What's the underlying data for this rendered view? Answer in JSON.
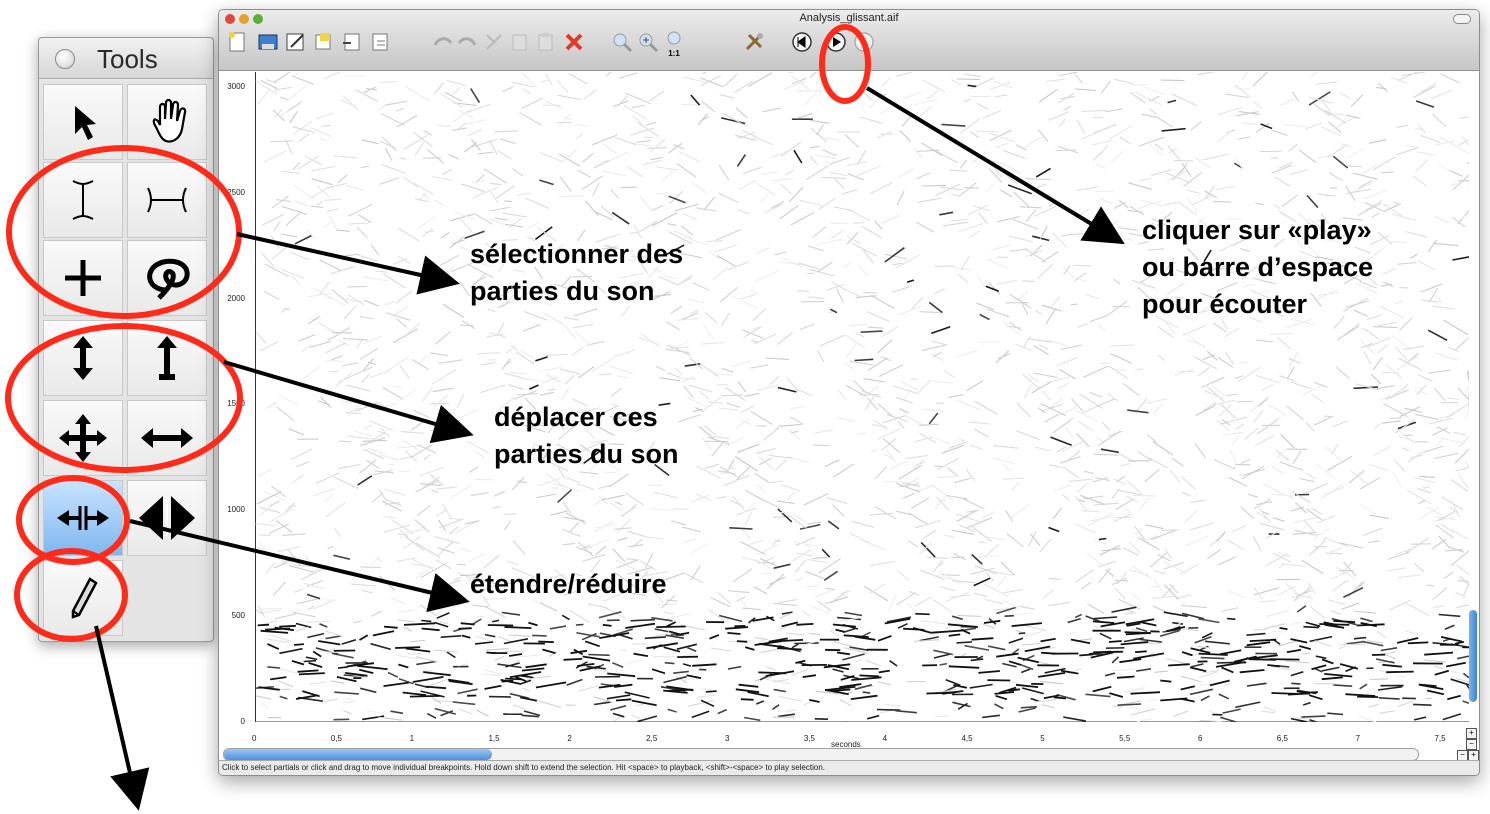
{
  "tools_palette": {
    "title": "Tools",
    "tools": [
      {
        "icon": "arrow-pointer-icon"
      },
      {
        "icon": "hand-icon"
      },
      {
        "icon": "vertical-ibeam-icon"
      },
      {
        "icon": "horizontal-ibeam-icon"
      },
      {
        "icon": "crosshair-icon"
      },
      {
        "icon": "lasso-icon"
      },
      {
        "icon": "vertical-move-icon"
      },
      {
        "icon": "vertical-up-move-icon"
      },
      {
        "icon": "four-way-move-icon"
      },
      {
        "icon": "horizontal-move-icon"
      },
      {
        "icon": "stretch-icon",
        "active": true
      },
      {
        "icon": "compress-icon"
      },
      {
        "icon": "pencil-icon"
      }
    ]
  },
  "window": {
    "title": "Analysis_glissant.aif",
    "toolbar_icons": [
      "new-icon",
      "save-icon",
      "edit-icon",
      "copy-doc-icon",
      "export-icon",
      "export2-icon",
      "undo-icon",
      "redo-icon",
      "cut-icon",
      "copy-icon",
      "paste-icon",
      "delete-icon",
      "zoom-out-icon",
      "zoom-in-icon",
      "zoom-1to1-icon",
      "tools-icon",
      "rewind-icon",
      "play-icon",
      "stop-icon"
    ],
    "zoom_1to1_label": "1:1",
    "status_text": "Click to select partials or click and drag to move individual breakpoints. Hold down shift to extend the selection. Hit <space> to playback, <shift>-<space> to play selection."
  },
  "chart_data": {
    "type": "scatter",
    "xlabel": "seconds",
    "ylabel": "",
    "xlim": [
      0,
      7.7
    ],
    "ylim": [
      0,
      3070
    ],
    "x_ticks": [
      "0",
      "0,5",
      "1",
      "1,5",
      "2",
      "2,5",
      "3",
      "3,5",
      "4",
      "4,5",
      "5",
      "5,5",
      "6",
      "6,5",
      "7",
      "7,5"
    ],
    "y_ticks": [
      "0",
      "500",
      "1000",
      "1500",
      "2000",
      "2500",
      "3000"
    ],
    "description": "spectral partials (sinusoidal tracks), dense in low frequencies"
  },
  "annotations": {
    "select": "sélectionner des parties du son",
    "move": "déplacer ces parties du son",
    "stretch": "étendre/réduire",
    "play": "cliquer sur «play» ou barre d’espace pour écouter"
  }
}
